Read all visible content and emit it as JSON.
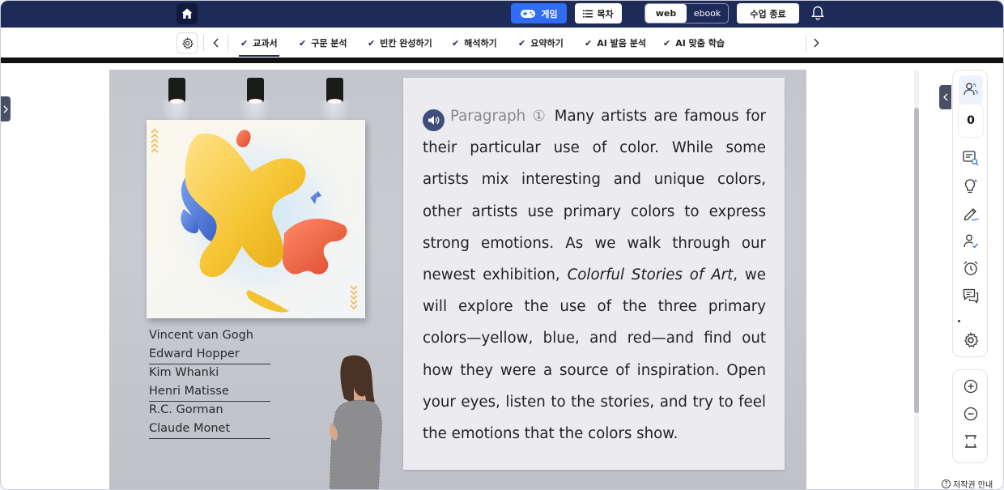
{
  "topbar": {
    "game_label": "게임",
    "toc_label": "목차",
    "view_modes": [
      "web",
      "ebook"
    ],
    "active_view_mode": "web",
    "end_class_label": "수업 종료"
  },
  "tabs": [
    {
      "label": "교과서",
      "active": true
    },
    {
      "label": "구문 분석",
      "active": false
    },
    {
      "label": "빈칸 완성하기",
      "active": false
    },
    {
      "label": "해석하기",
      "active": false
    },
    {
      "label": "요약하기",
      "active": false
    },
    {
      "label": "AI 발음 분석",
      "active": false
    },
    {
      "label": "AI 맞춤 학습",
      "active": false
    }
  ],
  "content": {
    "artists": [
      {
        "name": "Vincent van Gogh",
        "underlined": false
      },
      {
        "name": "Edward Hopper",
        "underlined": true
      },
      {
        "name": "Kim Whanki",
        "underlined": false
      },
      {
        "name": "Henri Matisse",
        "underlined": true
      },
      {
        "name": "R.C. Gorman",
        "underlined": false
      },
      {
        "name": "Claude Monet",
        "underlined": true
      }
    ],
    "paragraph_label": "Paragraph",
    "paragraph_number": "①",
    "paragraph_text_before": "Many artists are famous for their particular use of color. While some artists mix interesting and unique colors, other artists use primary colors to express strong emotions. As we walk through our newest exhibition, ",
    "paragraph_title_italic": "Colorful Stories of Art",
    "paragraph_text_after": ", we will explore the use of the three primary colors—yellow, blue, and red—and find out how they were a source of inspiration. Open your eyes, listen to the stories, and try to feel the emotions that the colors show."
  },
  "right_toolbar": {
    "participant_count": "0",
    "icons": [
      "users-icon",
      "search-text-icon",
      "idea-icon",
      "pen-icon",
      "user-check-icon",
      "alarm-icon",
      "chat-icon",
      "settings-icon"
    ],
    "zoom_icons": [
      "zoom-in-icon",
      "zoom-out-icon",
      "fit-width-icon"
    ]
  },
  "footer": {
    "copyright_label": "저작권 안내"
  },
  "colors": {
    "nav_bg": "#1e2a57",
    "game_button": "#2f6df5",
    "speaker_icon": "#3f4e7a"
  }
}
